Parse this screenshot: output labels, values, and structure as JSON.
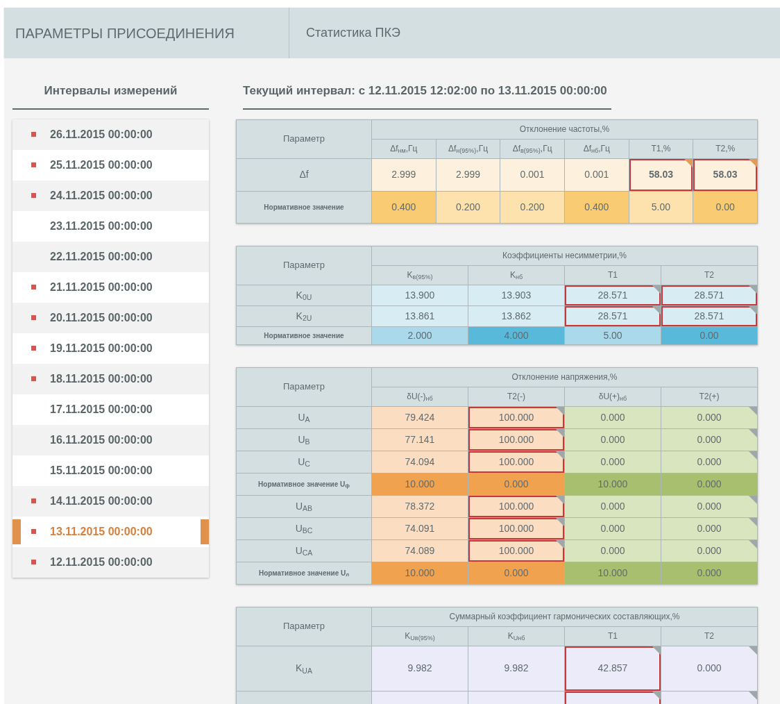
{
  "tabs": [
    {
      "label": "ПАРАМЕТРЫ ПРИСОЕДИНЕНИЯ"
    },
    {
      "label": "Статистика ПКЭ"
    }
  ],
  "sidebar": {
    "title": "Интервалы измерений",
    "items": [
      {
        "label": "26.11.2015 00:00:00",
        "flagged": true,
        "selected": false
      },
      {
        "label": "25.11.2015 00:00:00",
        "flagged": true,
        "selected": false
      },
      {
        "label": "24.11.2015 00:00:00",
        "flagged": true,
        "selected": false
      },
      {
        "label": "23.11.2015 00:00:00",
        "flagged": false,
        "selected": false
      },
      {
        "label": "22.11.2015 00:00:00",
        "flagged": false,
        "selected": false
      },
      {
        "label": "21.11.2015 00:00:00",
        "flagged": true,
        "selected": false
      },
      {
        "label": "20.11.2015 00:00:00",
        "flagged": true,
        "selected": false
      },
      {
        "label": "19.11.2015 00:00:00",
        "flagged": true,
        "selected": false
      },
      {
        "label": "18.11.2015 00:00:00",
        "flagged": true,
        "selected": false
      },
      {
        "label": "17.11.2015 00:00:00",
        "flagged": false,
        "selected": false
      },
      {
        "label": "16.11.2015 00:00:00",
        "flagged": false,
        "selected": false
      },
      {
        "label": "15.11.2015 00:00:00",
        "flagged": false,
        "selected": false
      },
      {
        "label": "14.11.2015 00:00:00",
        "flagged": true,
        "selected": false
      },
      {
        "label": "13.11.2015 00:00:00",
        "flagged": true,
        "selected": true
      },
      {
        "label": "12.11.2015 00:00:00",
        "flagged": true,
        "selected": false
      }
    ]
  },
  "current_interval": "Текущий интервал: с 12.11.2015 12:02:00 по 13.11.2015 00:00:00",
  "tables": [
    {
      "param_header": "Параметр",
      "title": "Отклонение частоты,%",
      "columns": [
        "Δf$_{нм}$,Гц",
        "Δf$_{н(95%)}$,Гц",
        "Δf$_{в(95%)}$,Гц",
        "Δf$_{нб}$,Гц",
        "Т1,%",
        "Т2,%"
      ],
      "rows": [
        {
          "kind": "data",
          "label": "Δf",
          "cells": [
            {
              "text": "2.999",
              "color": "#fdf0dc"
            },
            {
              "text": "2.999",
              "color": "#fdf0dc"
            },
            {
              "text": "0.001",
              "color": "#fdf0dc"
            },
            {
              "text": "0.001",
              "color": "#fdf0dc"
            },
            {
              "text": "58.03",
              "color": "#fdf0dc",
              "alert": true,
              "bold": true,
              "marked": true,
              "warning": true
            },
            {
              "text": "58.03",
              "color": "#fdf0dc",
              "alert": true,
              "bold": true,
              "marked": true,
              "warning": true
            }
          ]
        },
        {
          "kind": "norm",
          "label": "Нормативное значение",
          "cells": [
            {
              "text": "0.400",
              "color": "#f9cb72"
            },
            {
              "text": "0.200",
              "color": "#fde2ad"
            },
            {
              "text": "0.200",
              "color": "#fde2ad"
            },
            {
              "text": "0.400",
              "color": "#f9cb72"
            },
            {
              "text": "5.00",
              "color": "#fde2ad"
            },
            {
              "text": "0.00",
              "color": "#f9cb72"
            }
          ]
        }
      ]
    },
    {
      "param_header": "Параметр",
      "title": "Коэффициенты несимметрии,%",
      "columns": [
        "K$_{в(95%)}$",
        "K$_{нб}$",
        "Т1",
        "Т2"
      ],
      "rows": [
        {
          "kind": "data",
          "label": "K$_{0U}$",
          "cells": [
            {
              "text": "13.900",
              "color": "#d8ecf3"
            },
            {
              "text": "13.903",
              "color": "#d8ecf3"
            },
            {
              "text": "28.571",
              "color": "#d8ecf3",
              "alert": true,
              "marked": true
            },
            {
              "text": "28.571",
              "color": "#d8ecf3",
              "alert": true,
              "marked": true
            }
          ]
        },
        {
          "kind": "data",
          "label": "K$_{2U}$",
          "cells": [
            {
              "text": "13.861",
              "color": "#d8ecf3"
            },
            {
              "text": "13.862",
              "color": "#d8ecf3"
            },
            {
              "text": "28.571",
              "color": "#d8ecf3",
              "alert": true,
              "marked": true
            },
            {
              "text": "28.571",
              "color": "#d8ecf3",
              "alert": true,
              "marked": true
            }
          ]
        },
        {
          "kind": "norm",
          "label": "Нормативное значение",
          "cells": [
            {
              "text": "2.000",
              "color": "#a9d9ea"
            },
            {
              "text": "4.000",
              "color": "#58b9da"
            },
            {
              "text": "5.00",
              "color": "#a9d9ea"
            },
            {
              "text": "0.00",
              "color": "#58b9da"
            }
          ]
        }
      ]
    },
    {
      "param_header": "Параметр",
      "title": "Отклонение напряжения,%",
      "columns": [
        "δU(-)$_{нб}$",
        "T2(-)",
        "δU(+)$_{нб}$",
        "T2(+)"
      ],
      "rows": [
        {
          "kind": "data",
          "label": "U$_{A}$",
          "cells": [
            {
              "text": "79.424",
              "color": "#fbddc2"
            },
            {
              "text": "100.000",
              "color": "#fbddc2",
              "alert": true,
              "marked": true
            },
            {
              "text": "0.000",
              "color": "#d9e5bf"
            },
            {
              "text": "0.000",
              "color": "#d9e5bf",
              "marked": true
            }
          ]
        },
        {
          "kind": "data",
          "label": "U$_{B}$",
          "cells": [
            {
              "text": "77.141",
              "color": "#fbddc2"
            },
            {
              "text": "100.000",
              "color": "#fbddc2",
              "alert": true,
              "marked": true
            },
            {
              "text": "0.000",
              "color": "#d9e5bf"
            },
            {
              "text": "0.000",
              "color": "#d9e5bf",
              "marked": true
            }
          ]
        },
        {
          "kind": "data",
          "label": "U$_{C}$",
          "cells": [
            {
              "text": "74.094",
              "color": "#fbddc2"
            },
            {
              "text": "100.000",
              "color": "#fbddc2",
              "alert": true,
              "marked": true
            },
            {
              "text": "0.000",
              "color": "#d9e5bf"
            },
            {
              "text": "0.000",
              "color": "#d9e5bf",
              "marked": true
            }
          ]
        },
        {
          "kind": "norm",
          "label": "Нормативное значение U$_{ф}$",
          "cells": [
            {
              "text": "10.000",
              "color": "#f0a24f"
            },
            {
              "text": "0.000",
              "color": "#f0a24f"
            },
            {
              "text": "10.000",
              "color": "#a8bf70"
            },
            {
              "text": "0.000",
              "color": "#a8bf70"
            }
          ]
        },
        {
          "kind": "data",
          "label": "U$_{AB}$",
          "cells": [
            {
              "text": "78.372",
              "color": "#fbddc2"
            },
            {
              "text": "100.000",
              "color": "#fbddc2",
              "alert": true,
              "marked": true
            },
            {
              "text": "0.000",
              "color": "#d9e5bf"
            },
            {
              "text": "0.000",
              "color": "#d9e5bf",
              "marked": true
            }
          ]
        },
        {
          "kind": "data",
          "label": "U$_{BC}$",
          "cells": [
            {
              "text": "74.091",
              "color": "#fbddc2"
            },
            {
              "text": "100.000",
              "color": "#fbddc2",
              "alert": true,
              "marked": true
            },
            {
              "text": "0.000",
              "color": "#d9e5bf"
            },
            {
              "text": "0.000",
              "color": "#d9e5bf",
              "marked": true
            }
          ]
        },
        {
          "kind": "data",
          "label": "U$_{CA}$",
          "cells": [
            {
              "text": "74.089",
              "color": "#fbddc2"
            },
            {
              "text": "100.000",
              "color": "#fbddc2",
              "alert": true,
              "marked": true
            },
            {
              "text": "0.000",
              "color": "#d9e5bf"
            },
            {
              "text": "0.000",
              "color": "#d9e5bf",
              "marked": true
            }
          ]
        },
        {
          "kind": "norm",
          "label": "Нормативное значение U$_{л}$",
          "cells": [
            {
              "text": "10.000",
              "color": "#f0a24f"
            },
            {
              "text": "0.000",
              "color": "#f0a24f"
            },
            {
              "text": "10.000",
              "color": "#a8bf70"
            },
            {
              "text": "0.000",
              "color": "#a8bf70"
            }
          ]
        }
      ]
    },
    {
      "param_header": "Параметр",
      "title": "Суммарный коэффициент гармонических составляющих,%",
      "columns": [
        "K$_{Uв(95%)}$",
        "K$_{Uнб}$",
        "Т1",
        "Т2"
      ],
      "rows": [
        {
          "kind": "tall",
          "label": "K$_{U}$$_{A}$",
          "cells": [
            {
              "text": "9.982",
              "color": "#ebebfa"
            },
            {
              "text": "9.982",
              "color": "#ebebfa"
            },
            {
              "text": "42.857",
              "color": "#ebebfa",
              "alert": true,
              "marked": true
            },
            {
              "text": "0.000",
              "color": "#ebebfa",
              "marked": true
            }
          ]
        },
        {
          "kind": "cut",
          "cells": [
            {
              "color": "#ebebfa"
            },
            {
              "color": "#ebebfa"
            },
            {
              "color": "#ebebfa",
              "alert": true,
              "marked": true
            },
            {
              "color": "#ebebfa",
              "marked": true
            }
          ]
        }
      ]
    }
  ]
}
